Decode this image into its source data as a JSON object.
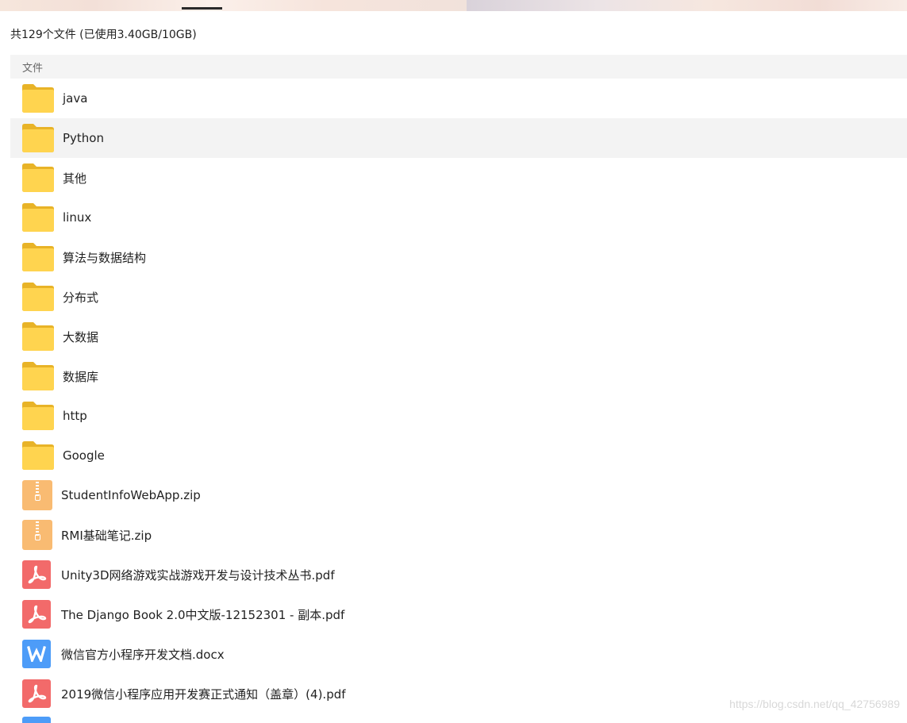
{
  "summary": "共129个文件 (已使用3.40GB/10GB)",
  "list_header": {
    "name_col": "文件"
  },
  "items": [
    {
      "name": "java",
      "type": "folder",
      "icon": "folder-icon"
    },
    {
      "name": "Python",
      "type": "folder",
      "icon": "folder-icon",
      "selected": true
    },
    {
      "name": "其他",
      "type": "folder",
      "icon": "folder-icon"
    },
    {
      "name": "linux",
      "type": "folder",
      "icon": "folder-icon"
    },
    {
      "name": "算法与数据结构",
      "type": "folder",
      "icon": "folder-icon"
    },
    {
      "name": "分布式",
      "type": "folder",
      "icon": "folder-icon"
    },
    {
      "name": "大数据",
      "type": "folder",
      "icon": "folder-icon"
    },
    {
      "name": "数据库",
      "type": "folder",
      "icon": "folder-icon"
    },
    {
      "name": "http",
      "type": "folder",
      "icon": "folder-icon"
    },
    {
      "name": "Google",
      "type": "folder",
      "icon": "folder-icon"
    },
    {
      "name": "StudentInfoWebApp.zip",
      "type": "zip",
      "icon": "zip-icon"
    },
    {
      "name": "RMI基础笔记.zip",
      "type": "zip",
      "icon": "zip-icon"
    },
    {
      "name": "Unity3D网络游戏实战游戏开发与设计技术丛书.pdf",
      "type": "pdf",
      "icon": "pdf-icon"
    },
    {
      "name": "The Django Book 2.0中文版-12152301 - 副本.pdf",
      "type": "pdf",
      "icon": "pdf-icon"
    },
    {
      "name": "微信官方小程序开发文档.docx",
      "type": "docx",
      "icon": "word-icon"
    },
    {
      "name": "2019微信小程序应用开发赛正式通知（盖章）(4).pdf",
      "type": "pdf",
      "icon": "pdf-icon"
    }
  ],
  "watermark": "https://blog.csdn.net/qq_42756989",
  "colors": {
    "folder": "#ffd44f",
    "folder_tab": "#e8b327",
    "zip": "#f9bb72",
    "pdf": "#f26a6a",
    "word": "#4d9cf8",
    "selected_row": "#f3f3f3",
    "header_bg": "#f4f4f4"
  }
}
